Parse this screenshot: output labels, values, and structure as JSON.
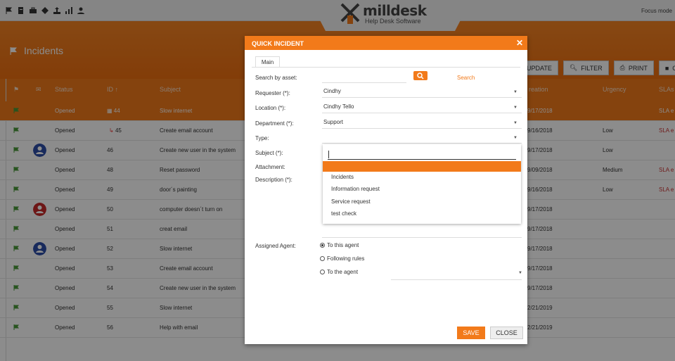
{
  "app": {
    "logo_text": "milldesk",
    "logo_sub": "Help Desk Software",
    "focus_mode": "Focus mode",
    "brand_color": "#f27a1a"
  },
  "header": {
    "title": "Incidents"
  },
  "toolbar": {
    "update": "UPDATE",
    "filter": "FILTER",
    "print": "PRINT",
    "more": "C"
  },
  "table": {
    "headers": {
      "status": "Status",
      "id": "ID",
      "subject": "Subject",
      "creation": "reation",
      "urgency": "Urgency",
      "slas": "SLAs"
    },
    "rows": [
      {
        "status": "Opened",
        "id": "44",
        "subject": "Slow internet",
        "creation": "9/17/2018",
        "urgency": "",
        "sla": "SLA e"
      },
      {
        "status": "Opened",
        "id": "45",
        "subject": "Create email account",
        "creation": "9/16/2018",
        "urgency": "Low",
        "sla": "SLA e"
      },
      {
        "status": "Opened",
        "id": "46",
        "subject": "Create new user in the system",
        "creation": "9/17/2018",
        "urgency": "Low",
        "sla": ""
      },
      {
        "status": "Opened",
        "id": "48",
        "subject": "Reset password",
        "creation": "9/09/2018",
        "urgency": "Medium",
        "sla": "SLA e"
      },
      {
        "status": "Opened",
        "id": "49",
        "subject": "door´s painting",
        "creation": "9/16/2018",
        "urgency": "Low",
        "sla": "SLA e"
      },
      {
        "status": "Opened",
        "id": "50",
        "subject": "computer doesn´t turn on",
        "creation": "9/17/2018",
        "urgency": "",
        "sla": ""
      },
      {
        "status": "Opened",
        "id": "51",
        "subject": "creat email",
        "creation": "9/17/2018",
        "urgency": "",
        "sla": ""
      },
      {
        "status": "Opened",
        "id": "52",
        "subject": "Slow internet",
        "creation": "9/17/2018",
        "urgency": "",
        "sla": ""
      },
      {
        "status": "Opened",
        "id": "53",
        "subject": "Create email account",
        "creation": "9/17/2018",
        "urgency": "",
        "sla": ""
      },
      {
        "status": "Opened",
        "id": "54",
        "subject": "Create new user in the system",
        "creation": "9/17/2018",
        "urgency": "",
        "sla": ""
      },
      {
        "status": "Opened",
        "id": "55",
        "subject": "Slow internet",
        "creation": "2/21/2019",
        "urgency": "",
        "sla": ""
      },
      {
        "status": "Opened",
        "id": "56",
        "subject": "Help with email",
        "creation": "2/21/2019",
        "urgency": "",
        "sla": ""
      }
    ]
  },
  "modal": {
    "title": "QUICK INCIDENT",
    "tab_main": "Main",
    "search_by_asset_label": "Search by asset:",
    "search_link": "Search",
    "requester_label": "Requester (*):",
    "requester_value": "Cindhy",
    "location_label": "Location (*):",
    "location_value": "Cindhy Tello",
    "department_label": "Department (*):",
    "department_value": "Support",
    "type_label": "Type:",
    "subject_label": "Subject (*):",
    "attachment_label": "Attachment:",
    "description_label": "Description (*):",
    "type_options": [
      "Incidents",
      "Information request",
      "Service request",
      "test check"
    ],
    "assigned_agent_label": "Assigned Agent:",
    "radio_this_agent": "To this agent",
    "radio_following_rules": "Following rules",
    "radio_to_agent": "To the agent",
    "save": "SAVE",
    "close": "CLOSE"
  }
}
